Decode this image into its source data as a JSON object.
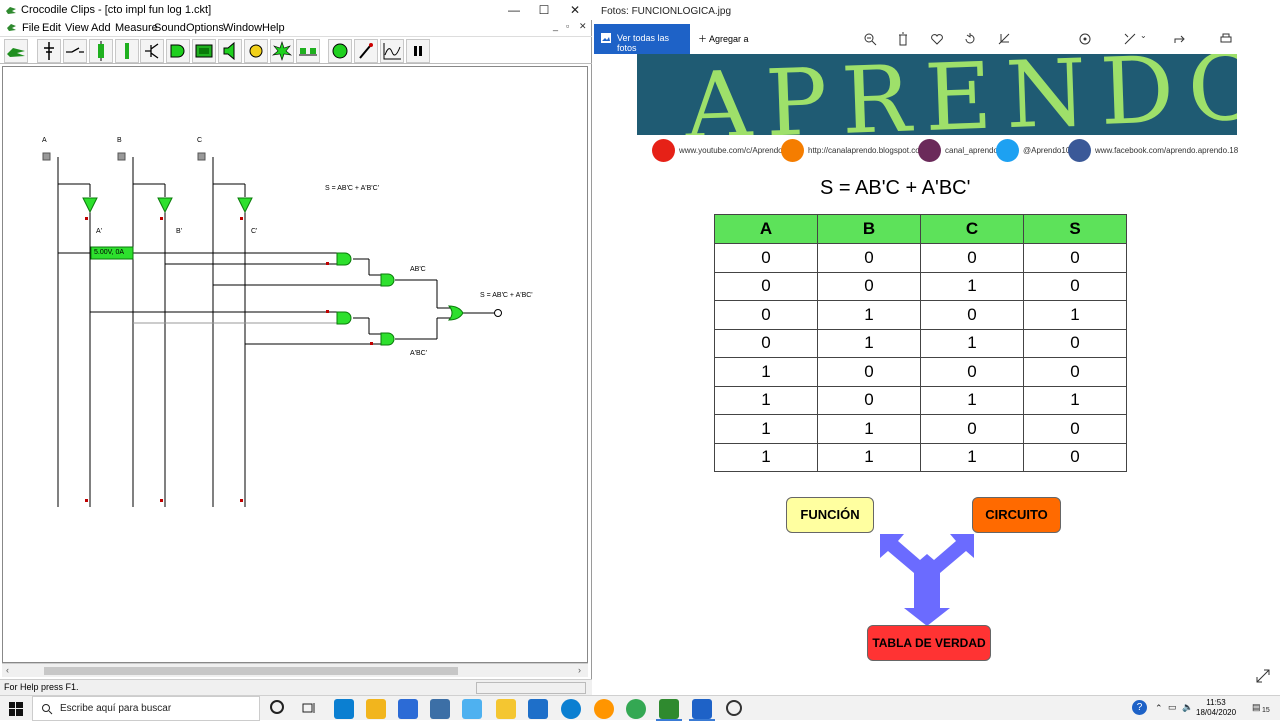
{
  "crocodile": {
    "title": "Crocodile Clips - [cto impl fun log 1.ckt]",
    "menu": [
      "File",
      "Edit",
      "View",
      "Add",
      "Measure",
      "Sound",
      "Options",
      "Window",
      "Help"
    ],
    "toolbar_icons": [
      "crocodile-icon",
      "power-supply-icon",
      "switch-icon",
      "resistor-icon",
      "capacitor-icon",
      "transistor-icon",
      "and-gate-icon",
      "chip-icon",
      "speaker-icon",
      "lamp-icon",
      "buzzer-icon",
      "wire-icon",
      "led-icon",
      "probe-icon",
      "graph-icon",
      "pause-icon"
    ],
    "circuit": {
      "inputs": [
        "A",
        "B",
        "C"
      ],
      "not_labels": [
        "A'",
        "B'",
        "C'"
      ],
      "probe_reading": "5.00V, 0A",
      "term1_label": "AB'C",
      "term2_label": "A'BC'",
      "output_label": "S = AB'C + A'BC'",
      "formula_note": "S = AB'C + A'B'C'"
    },
    "status": "For Help press F1."
  },
  "photos": {
    "title": "Fotos: FUNCIONLOGICA.jpg",
    "see_all": "Ver todas las fotos",
    "add_to": "Agregar a",
    "banner_text": "APRENDO",
    "social": [
      {
        "icon": "youtube-icon",
        "label": "www.youtube.com/c/Aprendo",
        "color": "#e62117"
      },
      {
        "icon": "blogger-icon",
        "label": "http://canalaprendo.blogspot.com",
        "color": "#f57d00"
      },
      {
        "icon": "instagram-icon",
        "label": "canal_aprendo",
        "color": "#8a3ab9"
      },
      {
        "icon": "twitter-icon",
        "label": "@Aprendo10",
        "color": "#1da1f2"
      },
      {
        "icon": "facebook-icon",
        "label": "www.facebook.com/aprendo.aprendo.18",
        "color": "#3b5998"
      }
    ],
    "formula": "S = AB'C + A'BC'",
    "table": {
      "headers": [
        "A",
        "B",
        "C",
        "S"
      ],
      "rows": [
        [
          "0",
          "0",
          "0",
          "0"
        ],
        [
          "0",
          "0",
          "1",
          "0"
        ],
        [
          "0",
          "1",
          "0",
          "1"
        ],
        [
          "0",
          "1",
          "1",
          "0"
        ],
        [
          "1",
          "0",
          "0",
          "0"
        ],
        [
          "1",
          "0",
          "1",
          "1"
        ],
        [
          "1",
          "1",
          "0",
          "0"
        ],
        [
          "1",
          "1",
          "1",
          "0"
        ]
      ]
    },
    "boxes": {
      "funcion": "FUNCIÓN",
      "circuito": "CIRCUITO",
      "tabla": "TABLA DE VERDAD"
    },
    "colors": {
      "header_green": "#5de25a",
      "funcion_bg": "#ffffa0",
      "circuito_bg": "#ff6a00",
      "tabla_bg": "#ff3333",
      "arrow": "#6b6bff"
    }
  },
  "taskbar": {
    "search_placeholder": "Escribe aquí para buscar",
    "time": "11:53",
    "date": "18/04/2020",
    "notif_count": "15"
  }
}
